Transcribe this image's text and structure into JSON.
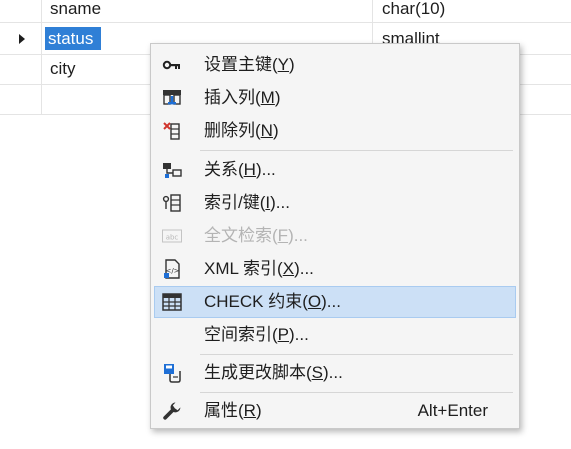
{
  "table": {
    "rows": [
      {
        "name": "sname",
        "type": "char(10)"
      },
      {
        "name": "status",
        "type": "smallint",
        "selected": true
      },
      {
        "name": "city",
        "type": ""
      }
    ]
  },
  "context_menu": {
    "items": [
      {
        "icon": "key-icon",
        "before": "设置主键(",
        "key": "Y",
        "after": ")",
        "shortcut": ""
      },
      {
        "icon": "insert-column-icon",
        "before": "插入列(",
        "key": "M",
        "after": ")",
        "shortcut": ""
      },
      {
        "icon": "delete-column-icon",
        "before": "删除列(",
        "key": "N",
        "after": ")",
        "shortcut": ""
      },
      {
        "icon": "relationships-icon",
        "before": "关系(",
        "key": "H",
        "after": ")...",
        "shortcut": ""
      },
      {
        "icon": "indexes-keys-icon",
        "before": "索引/键(",
        "key": "I",
        "after": ")...",
        "shortcut": ""
      },
      {
        "icon": "fulltext-icon",
        "before": "全文检索(",
        "key": "F",
        "after": ")...",
        "shortcut": "",
        "disabled": true
      },
      {
        "icon": "xml-index-icon",
        "before": "XML 索引(",
        "key": "X",
        "after": ")...",
        "shortcut": ""
      },
      {
        "icon": "check-constraint-icon",
        "before": "CHECK 约束(",
        "key": "O",
        "after": ")...",
        "shortcut": "",
        "highlighted": true
      },
      {
        "icon": "",
        "before": "空间索引(",
        "key": "P",
        "after": ")...",
        "shortcut": ""
      },
      {
        "icon": "generate-script-icon",
        "before": "生成更改脚本(",
        "key": "S",
        "after": ")...",
        "shortcut": ""
      },
      {
        "icon": "wrench-icon",
        "before": "属性(",
        "key": "R",
        "after": ")",
        "shortcut": "Alt+Enter"
      }
    ]
  },
  "colors": {
    "selection": "#2f7fd6",
    "menu_highlight": "#cce0f6",
    "menu_background": "#f5f5f5"
  }
}
